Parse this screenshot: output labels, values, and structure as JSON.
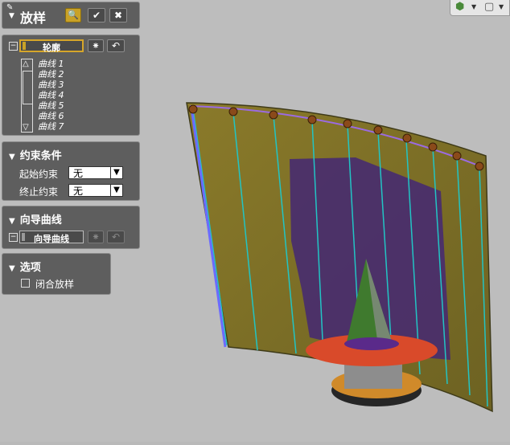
{
  "header": {
    "title": "放样"
  },
  "profile": {
    "field_label": "轮廓",
    "curves": [
      "曲线 1",
      "曲线 2",
      "曲线 3",
      "曲线 4",
      "曲线 5",
      "曲线 6",
      "曲线 7"
    ]
  },
  "constraints": {
    "title": "约束条件",
    "start_label": "起始约束",
    "start_value": "无",
    "end_label": "终止约束",
    "end_value": "无"
  },
  "guide": {
    "title": "向导曲线",
    "field_label": "向导曲线"
  },
  "options": {
    "title": "选项",
    "closed_loft_label": "闭合放样"
  },
  "colors": {
    "panel_bg": "#5e5e5e",
    "accent": "#c9a227",
    "viewport_bg": "#bdbdbd"
  },
  "icons": [
    "pin-icon",
    "filter-icon",
    "check-icon",
    "close-icon",
    "collapse-icon",
    "asterisk-icon",
    "undo-icon",
    "cube-icon",
    "view-cube-icon"
  ]
}
